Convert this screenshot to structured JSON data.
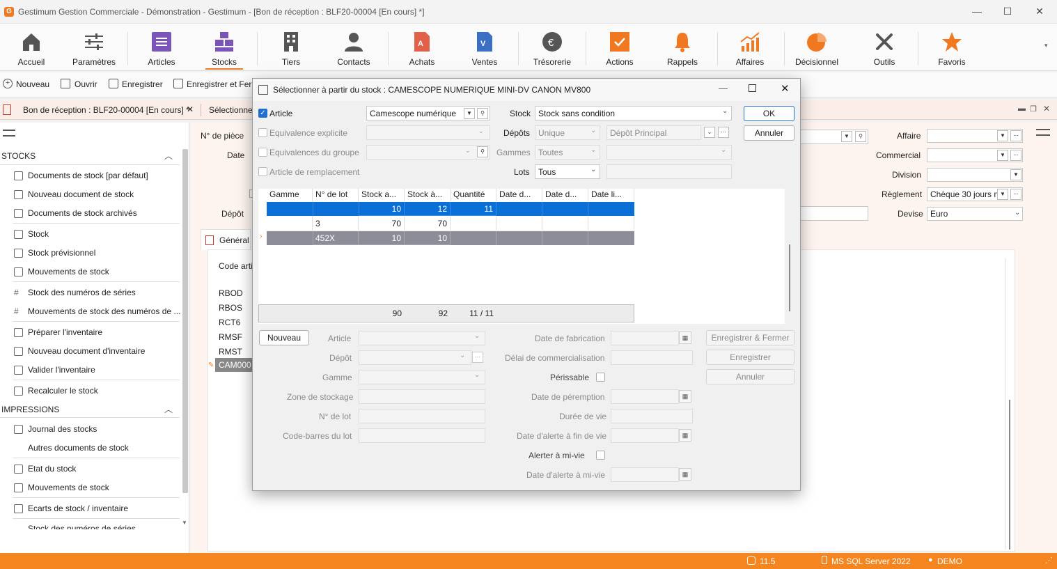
{
  "window": {
    "title": "Gestimum Gestion Commerciale - Démonstration - Gestimum - [Bon de réception : BLF20-00004 [En cours] *]",
    "logo_letter": "G",
    "min": "—",
    "max": "☐",
    "close": "✕"
  },
  "ribbon": {
    "items": [
      {
        "label": "Accueil"
      },
      {
        "label": "Paramètres"
      },
      {
        "label": "Articles"
      },
      {
        "label": "Stocks"
      },
      {
        "label": "Tiers"
      },
      {
        "label": "Contacts"
      },
      {
        "label": "Achats"
      },
      {
        "label": "Ventes"
      },
      {
        "label": "Trésorerie"
      },
      {
        "label": "Actions"
      },
      {
        "label": "Rappels"
      },
      {
        "label": "Affaires"
      },
      {
        "label": "Décisionnel"
      },
      {
        "label": "Outils"
      },
      {
        "label": "Favoris"
      }
    ],
    "colors": {
      "accent": "#f07820",
      "purple": "#7b54b8",
      "blue": "#3a6fc4"
    }
  },
  "toolbar": {
    "new": "Nouveau",
    "open": "Ouvrir",
    "save": "Enregistrer",
    "save_close": "Enregistrer et Ferm"
  },
  "doctabs": {
    "tab1": "Bon de réception : BLF20-00004 [En cours] *",
    "tab1_close": "✕",
    "tab2": "Sélectionne"
  },
  "sidebar": {
    "section1": "STOCKS",
    "items1": [
      "Documents de stock [par défaut]",
      "Nouveau document de stock",
      "Documents de stock archivés",
      "Stock",
      "Stock prévisionnel",
      "Mouvements de stock",
      "Stock des numéros de séries",
      "Mouvements de stock des numéros de ...",
      "Préparer l'inventaire",
      "Nouveau document d'inventaire",
      "Valider l'inventaire",
      "Recalculer le stock"
    ],
    "section2": "IMPRESSIONS",
    "items2": [
      "Journal des stocks",
      "Autres documents de stock",
      "Etat du stock",
      "Mouvements de stock",
      "Ecarts de stock / inventaire",
      "Stock des numéros de séries"
    ]
  },
  "form": {
    "piece_label": "N° de pièce",
    "date_label": "Date",
    "depot_label": "Dépôt",
    "tab_general": "Général",
    "col_code": "Code arti",
    "codes": [
      "RBOD",
      "RBOS",
      "RCT6",
      "RMSF",
      "RMST",
      "CAM000"
    ],
    "affaire_label": "Affaire",
    "commercial_label": "Commercial",
    "division_label": "Division",
    "reglement_label": "Règlement",
    "reglement_value": "Chèque 30 jours n",
    "devise_label": "Devise",
    "devise_value": "Euro"
  },
  "dialog": {
    "title": "Sélectionner à partir du stock : CAMESCOPE NUMERIQUE MINI-DV CANON MV800",
    "article_label": "Article",
    "article_value": "Camescope numérique",
    "equiv_label": "Equivalence explicite",
    "equiv_group_label": "Equivalences du groupe",
    "remplacement_label": "Article de remplacement",
    "stock_label": "Stock",
    "stock_value": "Stock sans condition",
    "depots_label": "Dépôts",
    "depots_value": "Unique",
    "depot_principal": "Dépôt Principal",
    "gammes_label": "Gammes",
    "gammes_value": "Toutes",
    "lots_label": "Lots",
    "lots_value": "Tous",
    "ok": "OK",
    "cancel": "Annuler",
    "grid": {
      "headers": [
        "Gamme",
        "N° de lot",
        "Stock a...",
        "Stock à...",
        "Quantité ...",
        "Date d...",
        "Date d...",
        "Date li..."
      ],
      "rows": [
        [
          "",
          "",
          "10",
          "12",
          "11",
          "",
          "",
          ""
        ],
        [
          "",
          "3",
          "70",
          "70",
          "",
          "",
          "",
          ""
        ],
        [
          "",
          "452X",
          "10",
          "10",
          "",
          "",
          "",
          ""
        ]
      ],
      "totals": [
        "",
        "",
        "90",
        "92",
        "11 / 11",
        "",
        "",
        ""
      ]
    },
    "new_button": "Nouveau",
    "f_article": "Article",
    "f_depot": "Dépôt",
    "f_gamme": "Gamme",
    "f_zone": "Zone de stockage",
    "f_lot": "N° de lot",
    "f_barcode": "Code-barres du lot",
    "f_fab": "Date de fabrication",
    "f_delai": "Délai de commercialisation",
    "f_perissable": "Périssable",
    "f_peremption": "Date de péremption",
    "f_duree": "Durée de vie",
    "f_alerte_fin": "Date d'alerte à fin de vie",
    "f_alerter_mi": "Alerter à mi-vie",
    "f_alerte_mi": "Date d'alerte à mi-vie",
    "btn_save_close": "Enregistrer & Fermer",
    "btn_save": "Enregistrer",
    "btn_cancel": "Annuler"
  },
  "status": {
    "version": "11.5",
    "db": "MS SQL Server 2022",
    "user": "DEMO"
  }
}
